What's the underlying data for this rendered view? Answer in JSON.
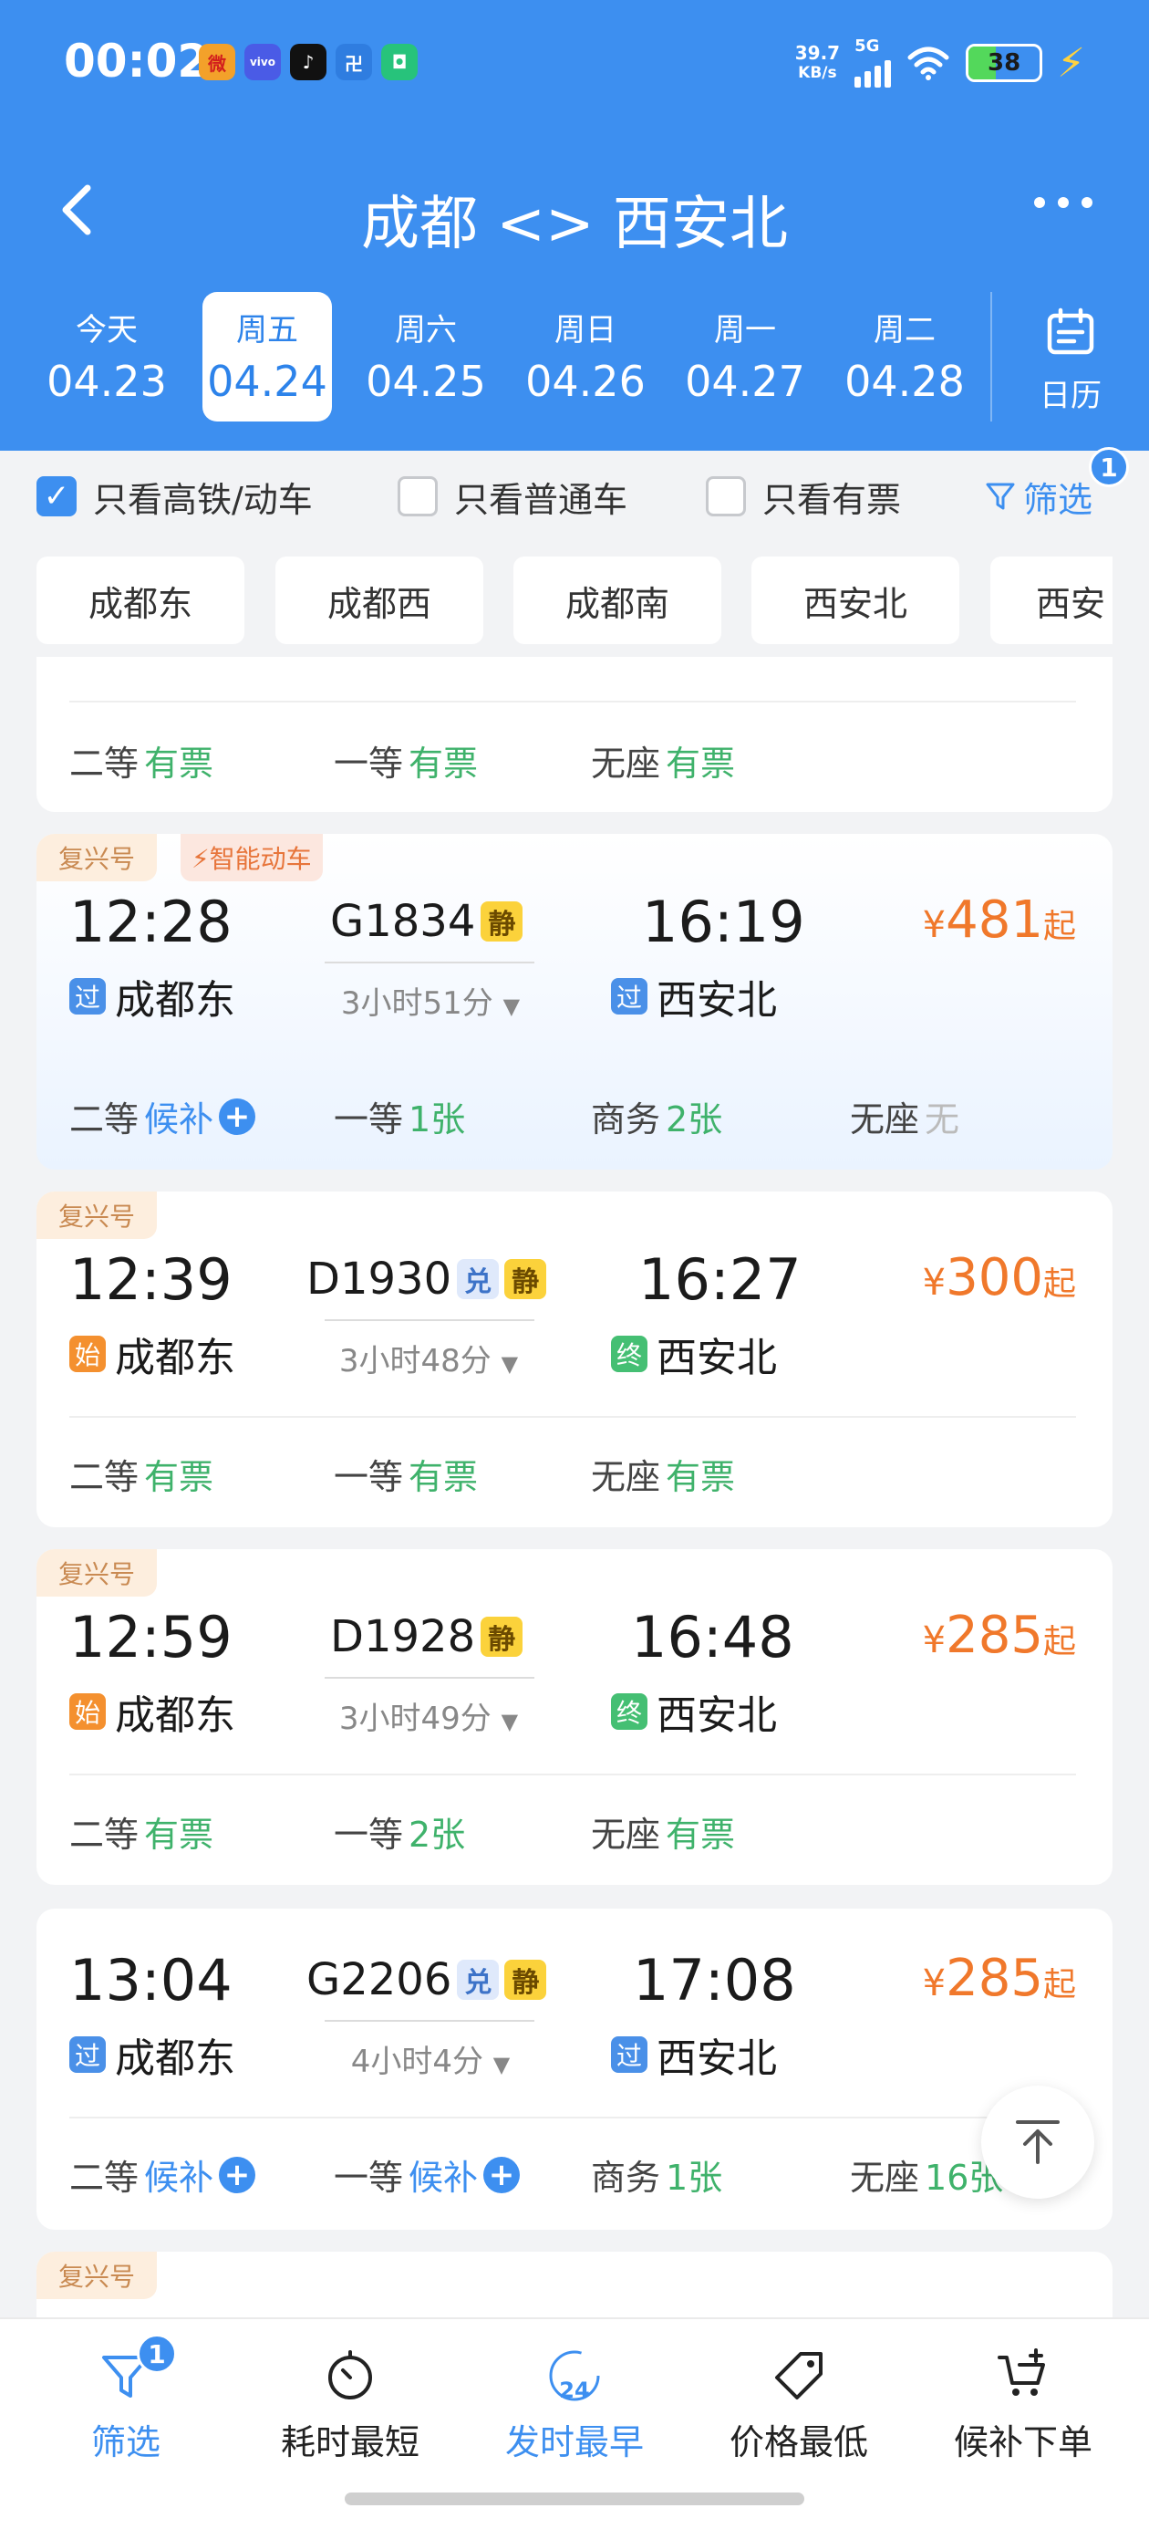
{
  "status_bar": {
    "time": "00:02",
    "net_speed_value": "39.7",
    "net_speed_unit": "KB/s",
    "network": "5G",
    "battery": "38",
    "app_icons": [
      "weibo-icon",
      "vivo-icon",
      "tiktok-icon",
      "app-icon",
      "shield-app-icon"
    ],
    "app_labels": [
      "微",
      "vivo",
      "♪",
      "卍",
      "◘"
    ]
  },
  "nav": {
    "title": "成都 <> 西安北"
  },
  "dates": [
    {
      "weekday": "今天",
      "date": "04.23"
    },
    {
      "weekday": "周五",
      "date": "04.24",
      "active": true
    },
    {
      "weekday": "周六",
      "date": "04.25"
    },
    {
      "weekday": "周日",
      "date": "04.26"
    },
    {
      "weekday": "周一",
      "date": "04.27"
    },
    {
      "weekday": "周二",
      "date": "04.28"
    }
  ],
  "calendar_label": "日历",
  "filters": {
    "high_speed": "只看高铁/动车",
    "normal": "只看普通车",
    "available": "只看有票",
    "filter_btn": "筛选",
    "filter_badge": "1"
  },
  "stations": [
    "成都东",
    "成都西",
    "成都南",
    "西安北",
    "西安"
  ],
  "partial_card": {
    "seats": [
      {
        "type": "二等",
        "status": "有票"
      },
      {
        "type": "一等",
        "status": "有票"
      },
      {
        "type": "无座",
        "status": "有票"
      }
    ]
  },
  "trains": [
    {
      "brand": "复兴号",
      "extra_tag": "智能动车",
      "dep_time": "12:28",
      "dep_station": "成都东",
      "dep_tag": "过",
      "train_no": "G1834",
      "tags": [
        "静"
      ],
      "duration": "3小时51分",
      "arr_time": "16:19",
      "arr_station": "西安北",
      "arr_tag": "过",
      "price_symbol": "¥",
      "price": "481",
      "price_suffix": "起",
      "seats": [
        {
          "type": "二等",
          "status": "候补",
          "kind": "wait"
        },
        {
          "type": "一等",
          "status": "1张",
          "kind": "ok"
        },
        {
          "type": "商务",
          "status": "2张",
          "kind": "ok"
        },
        {
          "type": "无座",
          "status": "无",
          "kind": "none"
        }
      ]
    },
    {
      "brand": "复兴号",
      "dep_time": "12:39",
      "dep_station": "成都东",
      "dep_tag": "始",
      "train_no": "D1930",
      "tags": [
        "兑",
        "静"
      ],
      "duration": "3小时48分",
      "arr_time": "16:27",
      "arr_station": "西安北",
      "arr_tag": "终",
      "price_symbol": "¥",
      "price": "300",
      "price_suffix": "起",
      "seats": [
        {
          "type": "二等",
          "status": "有票",
          "kind": "ok"
        },
        {
          "type": "一等",
          "status": "有票",
          "kind": "ok"
        },
        {
          "type": "无座",
          "status": "有票",
          "kind": "ok"
        }
      ]
    },
    {
      "brand": "复兴号",
      "dep_time": "12:59",
      "dep_station": "成都东",
      "dep_tag": "始",
      "train_no": "D1928",
      "tags": [
        "静"
      ],
      "duration": "3小时49分",
      "arr_time": "16:48",
      "arr_station": "西安北",
      "arr_tag": "终",
      "price_symbol": "¥",
      "price": "285",
      "price_suffix": "起",
      "seats": [
        {
          "type": "二等",
          "status": "有票",
          "kind": "ok"
        },
        {
          "type": "一等",
          "status": "2张",
          "kind": "ok"
        },
        {
          "type": "无座",
          "status": "有票",
          "kind": "ok"
        }
      ]
    },
    {
      "dep_time": "13:04",
      "dep_station": "成都东",
      "dep_tag": "过",
      "train_no": "G2206",
      "tags": [
        "兑",
        "静"
      ],
      "duration": "4小时4分",
      "arr_time": "17:08",
      "arr_station": "西安北",
      "arr_tag": "过",
      "price_symbol": "¥",
      "price": "285",
      "price_suffix": "起",
      "seats": [
        {
          "type": "二等",
          "status": "候补",
          "kind": "wait"
        },
        {
          "type": "一等",
          "status": "候补",
          "kind": "wait"
        },
        {
          "type": "商务",
          "status": "1张",
          "kind": "ok"
        },
        {
          "type": "无座",
          "status": "16张",
          "kind": "ok"
        }
      ]
    }
  ],
  "next_card_brand": "复兴号",
  "bottom_tabs": [
    {
      "label": "筛选",
      "badge": "1"
    },
    {
      "label": "耗时最短"
    },
    {
      "label": "发时最早",
      "icon_text": "24"
    },
    {
      "label": "价格最低"
    },
    {
      "label": "候补下单"
    }
  ],
  "colors": {
    "primary": "#3d8ff0",
    "ok": "#3fb26b",
    "price": "#f0782b"
  }
}
